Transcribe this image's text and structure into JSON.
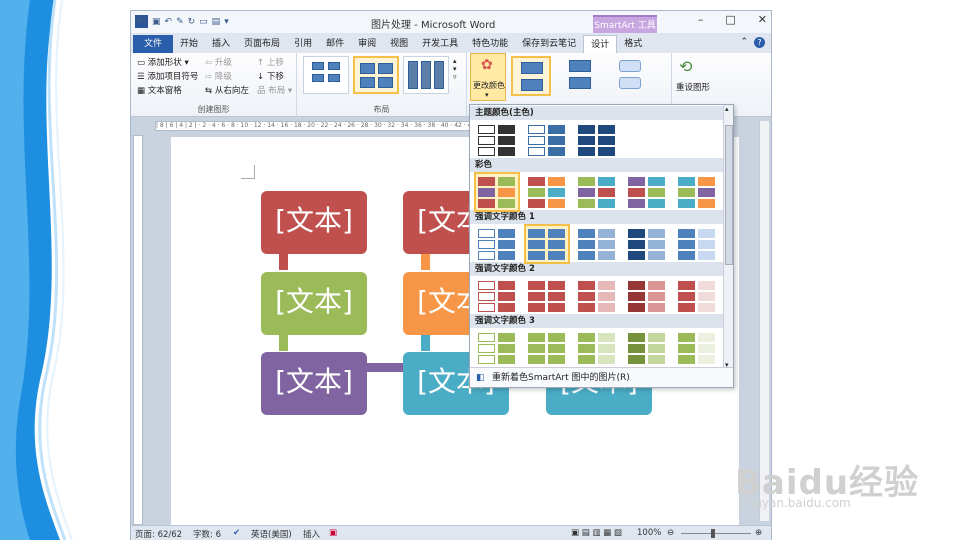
{
  "window": {
    "title": "图片处理 - Microsoft Word",
    "contextual_tab": "SmartArt 工具",
    "controls": [
      "–",
      "□",
      "✕"
    ]
  },
  "tabs": [
    "文件",
    "开始",
    "插入",
    "页面布局",
    "引用",
    "邮件",
    "审阅",
    "视图",
    "开发工具",
    "特色功能",
    "保存到云笔记",
    "设计",
    "格式"
  ],
  "ribbon": {
    "create_graphic": {
      "label": "创建图形",
      "add_shape": "添加形状",
      "add_bullet": "添加项目符号",
      "text_pane": "文本窗格",
      "promote": "升级",
      "demote": "降级",
      "right_to_left": "从右向左",
      "move_up": "上移",
      "move_down": "下移",
      "layout": "布局"
    },
    "layouts_label": "布局",
    "change_colors": "更改颜色",
    "reset_graphic": "重设图形"
  },
  "document": {
    "node_text": "[文本]",
    "nodes": [
      {
        "color": "#c0504d"
      },
      {
        "color": "#9bbb59"
      },
      {
        "color": "#8064a2"
      },
      {
        "color": "#c0504d"
      },
      {
        "color": "#f79646"
      },
      {
        "color": "#4bacc6"
      },
      {
        "color": "#4bacc6"
      }
    ]
  },
  "color_panel": {
    "sections": [
      {
        "title": "主题颜色(主色)"
      },
      {
        "title": "彩色"
      },
      {
        "title": "强调文字颜色 1"
      },
      {
        "title": "强调文字颜色 2"
      },
      {
        "title": "强调文字颜色 3"
      }
    ],
    "recolor_pictures": "重新着色SmartArt 图中的图片(R)"
  },
  "status": {
    "page": "页面: 62/62",
    "words": "字数: 6",
    "language": "英语(美国)",
    "mode": "插入",
    "zoom": "100%"
  },
  "watermark": {
    "brand": "Baidu经验",
    "url": "jingyan.baidu.com"
  }
}
